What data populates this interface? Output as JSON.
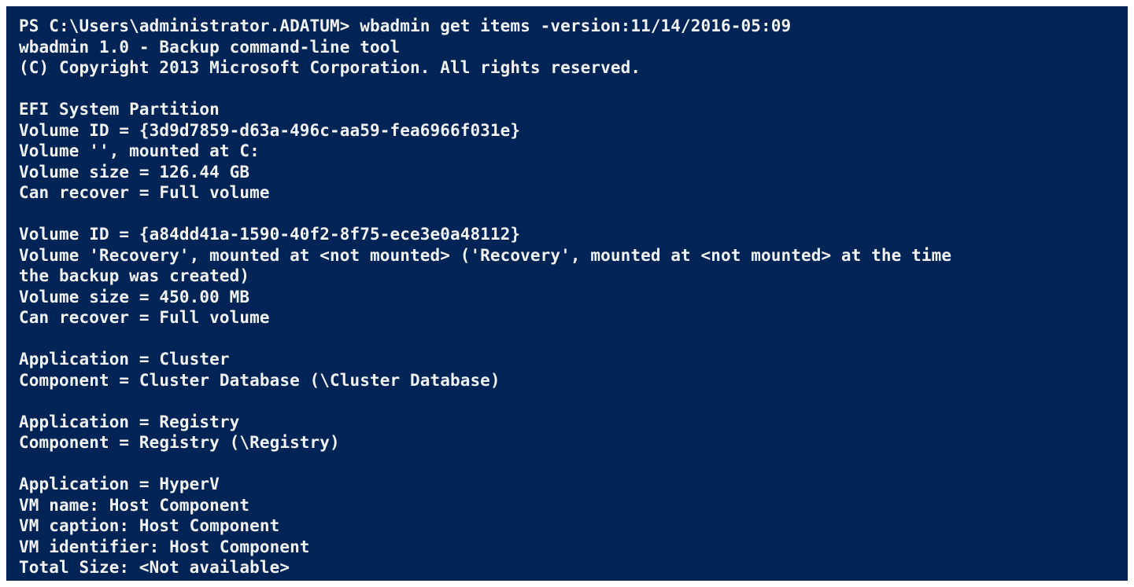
{
  "console": {
    "background": "#012456",
    "foreground": "#f2f2f2",
    "lines": [
      "PS C:\\Users\\administrator.ADATUM> wbadmin get items -version:11/14/2016-05:09",
      "wbadmin 1.0 - Backup command-line tool",
      "(C) Copyright 2013 Microsoft Corporation. All rights reserved.",
      "",
      "EFI System Partition",
      "Volume ID = {3d9d7859-d63a-496c-aa59-fea6966f031e}",
      "Volume '', mounted at C:",
      "Volume size = 126.44 GB",
      "Can recover = Full volume",
      "",
      "Volume ID = {a84dd41a-1590-40f2-8f75-ece3e0a48112}",
      "Volume 'Recovery', mounted at <not mounted> ('Recovery', mounted at <not mounted> at the time",
      "the backup was created)",
      "Volume size = 450.00 MB",
      "Can recover = Full volume",
      "",
      "Application = Cluster",
      "Component = Cluster Database (\\Cluster Database)",
      "",
      "Application = Registry",
      "Component = Registry (\\Registry)",
      "",
      "Application = HyperV",
      "VM name: Host Component",
      "VM caption: Host Component",
      "VM identifier: Host Component",
      "Total Size: <Not available>"
    ]
  }
}
